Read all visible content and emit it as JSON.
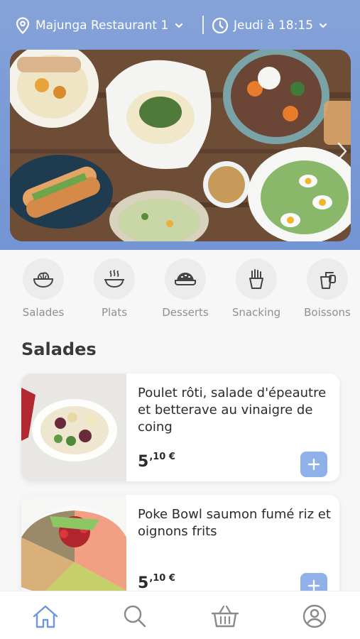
{
  "header": {
    "restaurant": "Majunga Restaurant 1",
    "pickup_time": "Jeudi à 18:15",
    "location_icon": "location-pin-icon",
    "clock_icon": "clock-icon"
  },
  "categories": [
    {
      "label": "Salades",
      "icon": "salad-bowl-icon"
    },
    {
      "label": "Plats",
      "icon": "hot-dish-icon"
    },
    {
      "label": "Desserts",
      "icon": "pie-icon"
    },
    {
      "label": "Snacking",
      "icon": "fries-icon"
    },
    {
      "label": "Boissons",
      "icon": "cup-icon"
    }
  ],
  "section": {
    "title": "Salades"
  },
  "products": [
    {
      "name": "Poulet rôti, salade d'épeautre et betterave au vinaigre de coing",
      "price_main": "5",
      "price_cents": ",10 €"
    },
    {
      "name": "Poke Bowl saumon fumé riz et oignons frits",
      "price_main": "5",
      "price_cents": ",10 €"
    }
  ],
  "bottom_nav": [
    {
      "icon": "home-icon",
      "active": true
    },
    {
      "icon": "search-icon",
      "active": false
    },
    {
      "icon": "basket-icon",
      "active": false
    },
    {
      "icon": "profile-icon",
      "active": false
    }
  ],
  "colors": {
    "accent": "#7b9bd6",
    "add_button": "#8fb0e8",
    "nav_active": "#6f96dc",
    "nav_inactive": "#8a8a8a"
  }
}
